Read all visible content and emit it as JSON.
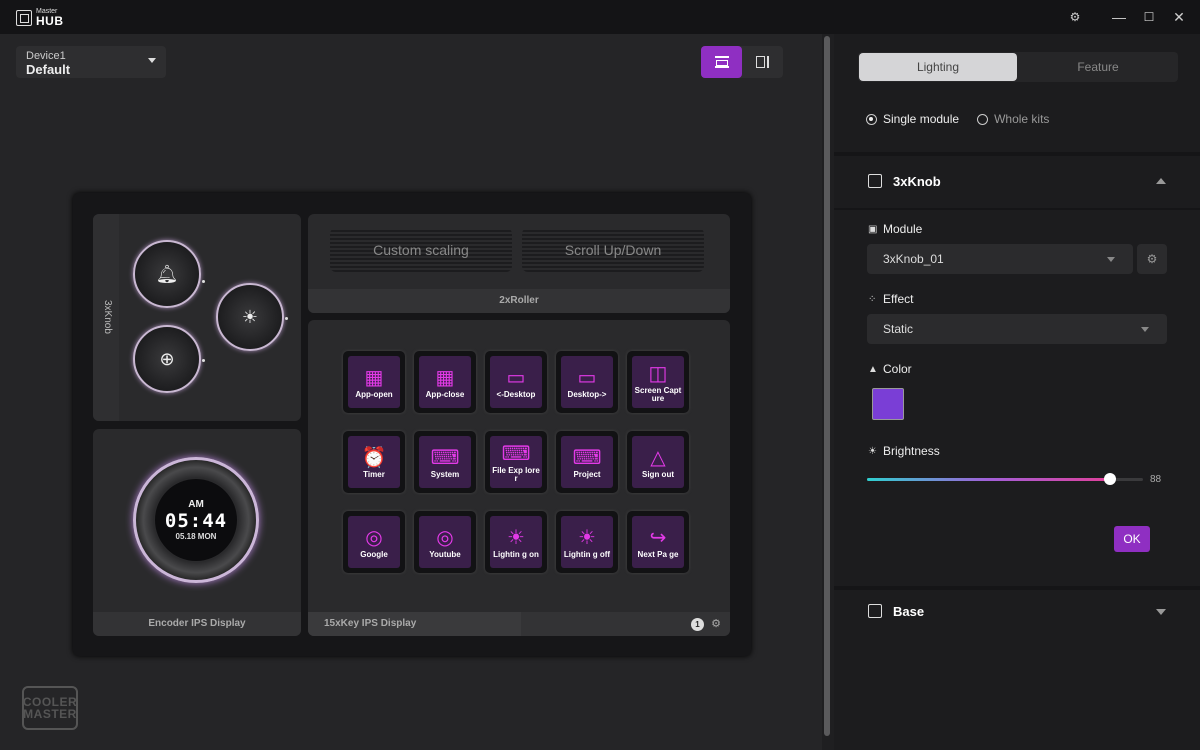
{
  "app": {
    "logo_small": "Master",
    "logo_big": "HUB"
  },
  "window": {
    "settings_icon": "gear-icon",
    "min": "—",
    "max": "☐",
    "close": "✕"
  },
  "device": {
    "label": "Device1",
    "profile": "Default"
  },
  "modules": {
    "knob_label": "3xKnob",
    "roller_left": "Custom scaling",
    "roller_right": "Scroll Up/Down",
    "roller_label": "2xRoller",
    "encoder": {
      "am": "AM",
      "time": "05:44",
      "date": "05.18 MON",
      "label": "Encoder IPS Display"
    },
    "keys_label": "15xKey IPS Display",
    "page_number": "1",
    "keys": [
      {
        "icon": "▦",
        "label": "App-open"
      },
      {
        "icon": "▦",
        "label": "App-close"
      },
      {
        "icon": "▭",
        "label": "<-Desktop"
      },
      {
        "icon": "▭",
        "label": "Desktop->"
      },
      {
        "icon": "◫",
        "label": "Screen Capture"
      },
      {
        "icon": "⏰",
        "label": "Timer"
      },
      {
        "icon": "⌨",
        "label": "System"
      },
      {
        "icon": "⌨",
        "label": "File Exp lorer"
      },
      {
        "icon": "⌨",
        "label": "Project"
      },
      {
        "icon": "△",
        "label": "Sign out"
      },
      {
        "icon": "◎",
        "label": "Google"
      },
      {
        "icon": "◎",
        "label": "Youtube"
      },
      {
        "icon": "☀",
        "label": "Lightin g on"
      },
      {
        "icon": "☀",
        "label": "Lightin g off"
      },
      {
        "icon": "↪",
        "label": "Next Pa ge"
      }
    ]
  },
  "brand": {
    "line1": "COOLER",
    "line2": "MASTER"
  },
  "panel": {
    "tabs": [
      "Lighting",
      "Feature"
    ],
    "modes": [
      "Single module",
      "Whole kits"
    ],
    "section_title": "3xKnob",
    "module_label": "Module",
    "module_value": "3xKnob_01",
    "effect_label": "Effect",
    "effect_value": "Static",
    "color_label": "Color",
    "color_value": "#7a3ed6",
    "brightness_label": "Brightness",
    "brightness_value": "88",
    "brightness_fraction": 0.88,
    "ok_label": "OK",
    "base_title": "Base"
  }
}
